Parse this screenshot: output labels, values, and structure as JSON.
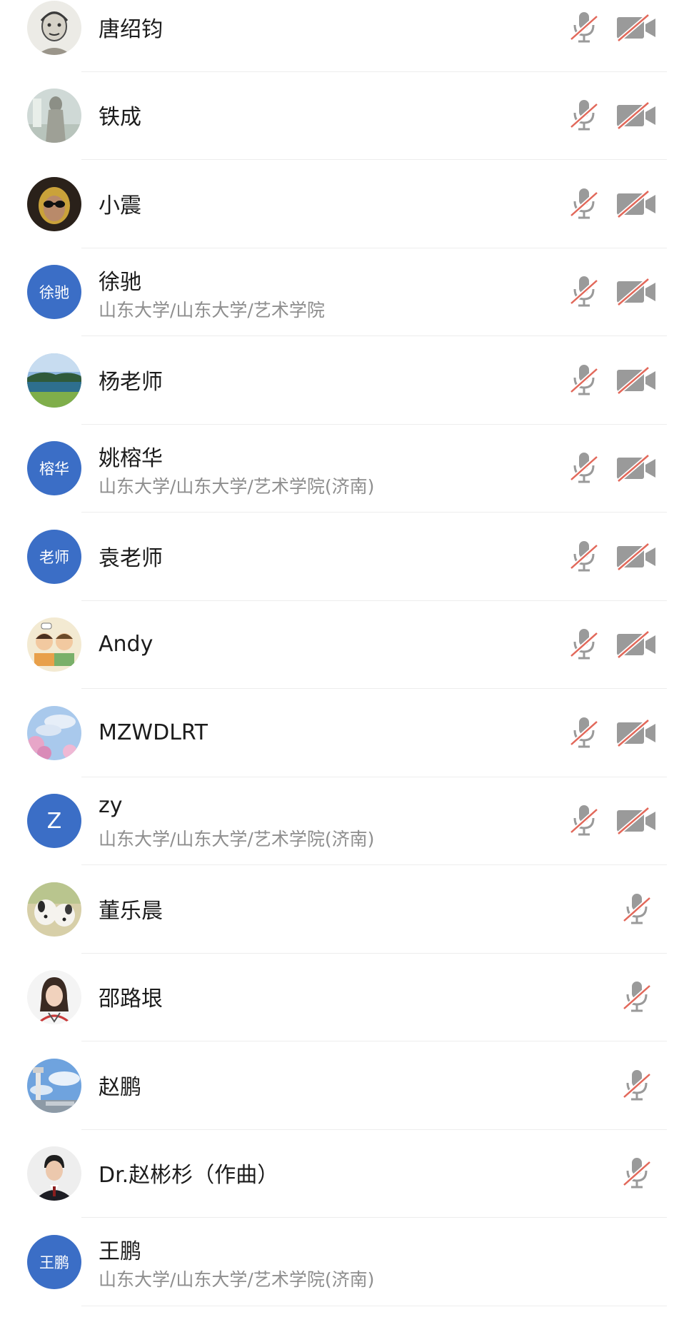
{
  "participants": [
    {
      "name": "唐绍钧",
      "avatar_type": "image",
      "avatar_desc": "sketch-portrait",
      "mic": "muted",
      "camera": "off"
    },
    {
      "name": "铁成",
      "avatar_type": "image",
      "avatar_desc": "statue",
      "mic": "muted",
      "camera": "off"
    },
    {
      "name": "小震",
      "avatar_type": "image",
      "avatar_desc": "helmet-goggles",
      "mic": "muted",
      "camera": "off"
    },
    {
      "name": "徐驰",
      "org": "山东大学/山东大学/艺术学院",
      "avatar_type": "text",
      "avatar_text": "徐驰",
      "mic": "muted",
      "camera": "off"
    },
    {
      "name": "杨老师",
      "avatar_type": "image",
      "avatar_desc": "lake-landscape",
      "mic": "muted",
      "camera": "off"
    },
    {
      "name": "姚榕华",
      "org": "山东大学/山东大学/艺术学院(济南)",
      "avatar_type": "text",
      "avatar_text": "榕华",
      "mic": "muted",
      "camera": "off"
    },
    {
      "name": "袁老师",
      "avatar_type": "text",
      "avatar_text": "老师",
      "mic": "muted",
      "camera": "off"
    },
    {
      "name": "Andy",
      "avatar_type": "image",
      "avatar_desc": "cartoon-kids",
      "mic": "muted",
      "camera": "off"
    },
    {
      "name": "MZWDLRT",
      "avatar_type": "image",
      "avatar_desc": "cherry-blossom-sky",
      "mic": "muted",
      "camera": "off"
    },
    {
      "name": "zy",
      "org": "山东大学/山东大学/艺术学院(济南)",
      "avatar_type": "text",
      "avatar_text": "Z",
      "mic": "muted",
      "camera": "off"
    },
    {
      "name": "董乐晨",
      "avatar_type": "image",
      "avatar_desc": "two-dogs",
      "mic": "muted"
    },
    {
      "name": "邵路垠",
      "avatar_type": "image",
      "avatar_desc": "woman-portrait",
      "mic": "muted"
    },
    {
      "name": "赵鹏",
      "avatar_type": "image",
      "avatar_desc": "airport-tower",
      "mic": "muted"
    },
    {
      "name": "Dr.赵彬杉（作曲）",
      "avatar_type": "image",
      "avatar_desc": "man-portrait",
      "mic": "muted"
    },
    {
      "name": "王鹏",
      "org": "山东大学/山东大学/艺术学院(济南)",
      "avatar_type": "text",
      "avatar_text": "王鹏"
    }
  ],
  "colors": {
    "avatar_bg": "#3b6ec6",
    "icon_gray": "#9a9a9a",
    "muted_slash": "#e2685a",
    "secondary_text": "#8e8e8e",
    "divider": "#ededed"
  }
}
